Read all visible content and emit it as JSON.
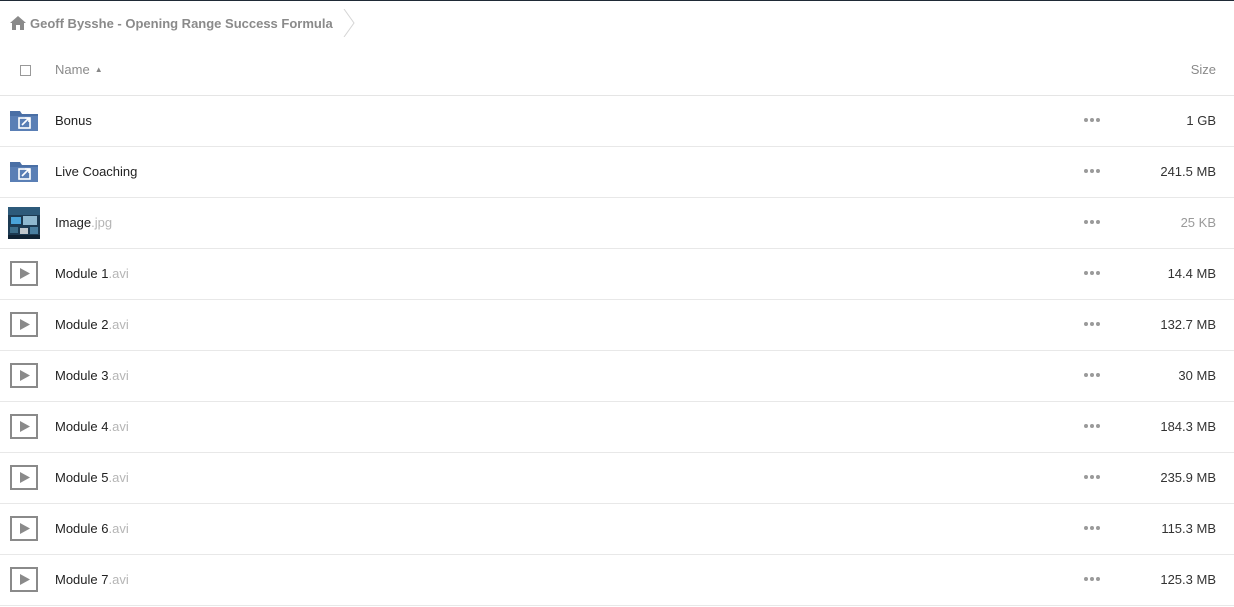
{
  "breadcrumb": {
    "items": [
      {
        "label": "Geoff Bysshe - Opening Range Success Formula",
        "icon": "home-icon"
      }
    ]
  },
  "columns": {
    "name": "Name",
    "size": "Size",
    "sort": "ascending"
  },
  "files": [
    {
      "name": "Bonus",
      "ext": "",
      "type": "shared-folder",
      "icon": "shared-folder-icon",
      "size": "1 GB"
    },
    {
      "name": "Live Coaching",
      "ext": "",
      "type": "shared-folder",
      "icon": "shared-folder-icon",
      "size": "241.5 MB"
    },
    {
      "name": "Image",
      "ext": ".jpg",
      "type": "image",
      "icon": "image-thumbnail",
      "size": "25 KB"
    },
    {
      "name": "Module 1",
      "ext": ".avi",
      "type": "video",
      "icon": "video-play-icon",
      "size": "14.4 MB"
    },
    {
      "name": "Module 2",
      "ext": ".avi",
      "type": "video",
      "icon": "video-play-icon",
      "size": "132.7 MB"
    },
    {
      "name": "Module 3",
      "ext": ".avi",
      "type": "video",
      "icon": "video-play-icon",
      "size": "30 MB"
    },
    {
      "name": "Module 4",
      "ext": ".avi",
      "type": "video",
      "icon": "video-play-icon",
      "size": "184.3 MB"
    },
    {
      "name": "Module 5",
      "ext": ".avi",
      "type": "video",
      "icon": "video-play-icon",
      "size": "235.9 MB"
    },
    {
      "name": "Module 6",
      "ext": ".avi",
      "type": "video",
      "icon": "video-play-icon",
      "size": "115.3 MB"
    },
    {
      "name": "Module 7",
      "ext": ".avi",
      "type": "video",
      "icon": "video-play-icon",
      "size": "125.3 MB"
    }
  ],
  "colors": {
    "folder": "#4a6fa5",
    "muted_text": "#8a8a8a",
    "extension": "#b5b5b5",
    "divider": "#e8e8e8"
  }
}
